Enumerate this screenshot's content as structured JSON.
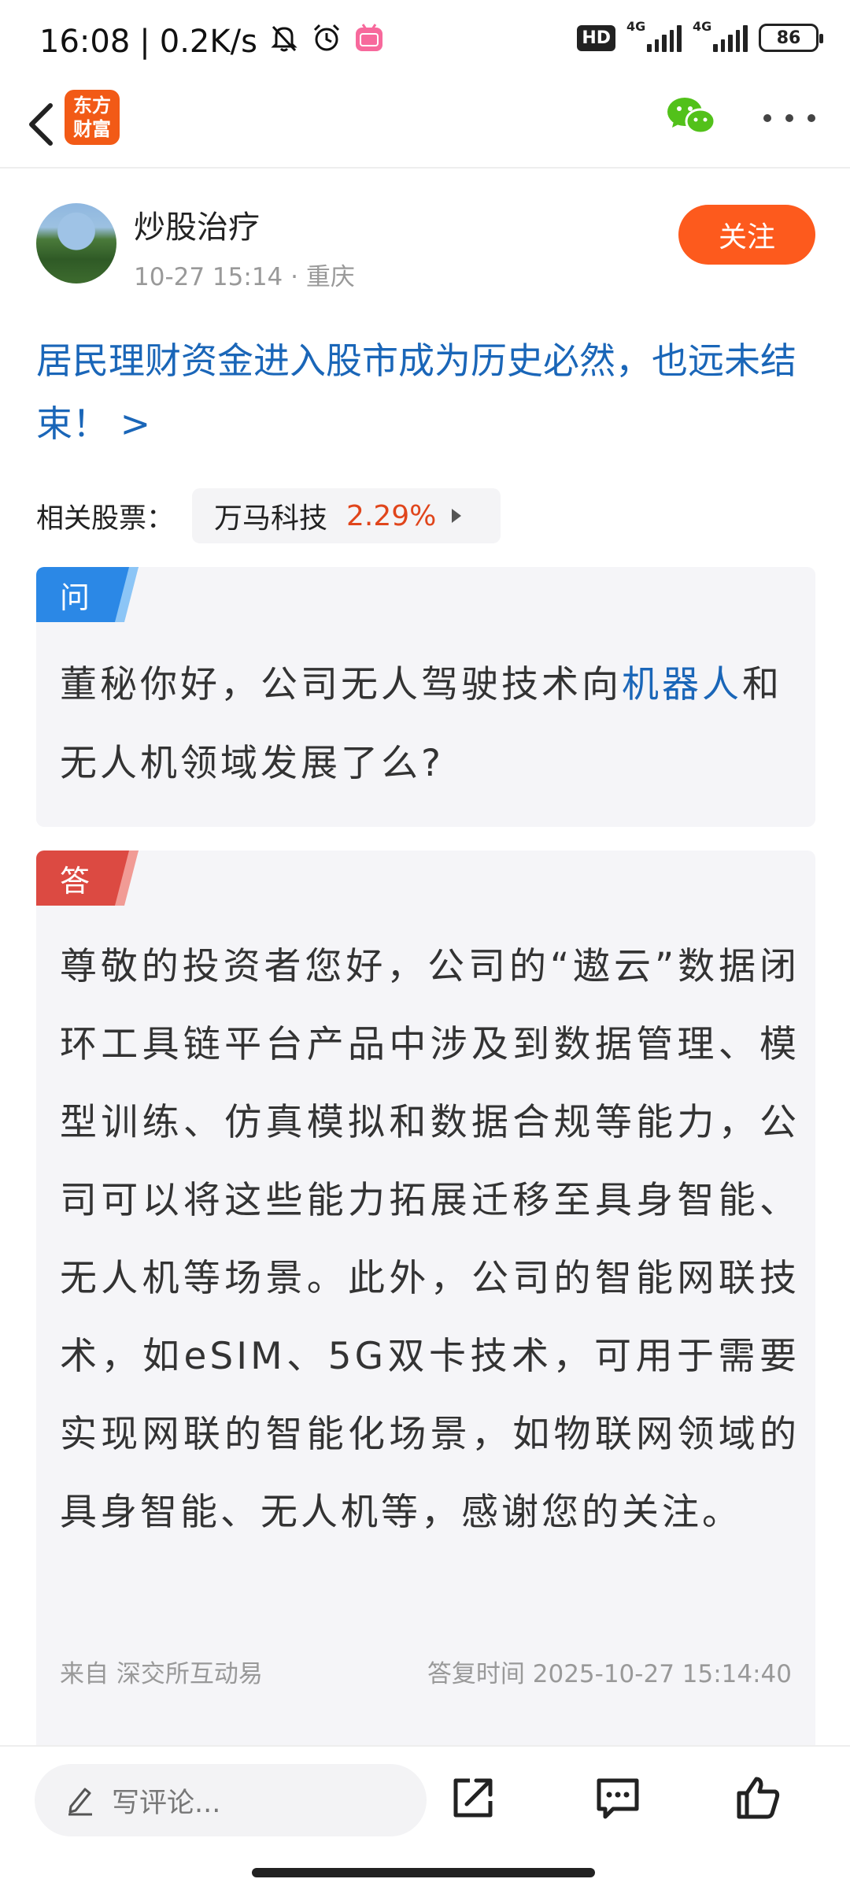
{
  "status_bar": {
    "time": "16:08",
    "net_speed": "0.2K/s",
    "hd_label": "HD",
    "sim1_label": "4G",
    "sim2_label": "4G",
    "battery": "86"
  },
  "nav": {
    "logo_text": "东方财富"
  },
  "author": {
    "name": "炒股治疗",
    "date": "10-27 15:14",
    "location": "重庆",
    "follow_label": "关注"
  },
  "post": {
    "title": "居民理财资金进入股市成为历史必然，也远未结束！ >"
  },
  "related": {
    "label": "相关股票：",
    "stock_name": "万马科技",
    "stock_change": "2.29%"
  },
  "question": {
    "tag": "问",
    "text_before": "董秘你好，公司无人驾驶技术向",
    "highlight": "机器人",
    "text_after": "和无人机领域发展了么?"
  },
  "answer": {
    "tag": "答",
    "text": "尊敬的投资者您好，公司的“遨云”数据闭环工具链平台产品中涉及到数据管理、模型训练、仿真模拟和数据合规等能力，公司可以将这些能力拓展迁移至具身智能、无人机等场景。此外，公司的智能网联技术，如eSIM、5G双卡技术，可用于需要实现网联的智能化场景，如物联网领域的具身智能、无人机等，感谢您的关注。",
    "source": "来自 深交所互动易",
    "reply_time": "答复时间 2025-10-27 15:14:40"
  },
  "bottom": {
    "comment_placeholder": "写评论..."
  },
  "colors": {
    "accent_orange": "#fd5a1d",
    "link_blue": "#1a66b8",
    "stock_up": "#e0451b"
  }
}
